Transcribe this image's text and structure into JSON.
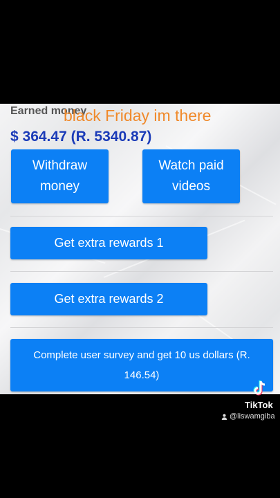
{
  "header": {
    "label": "Earned money",
    "overlay_text": "black Friday im there",
    "amount": "$ 364.47   (R. 5340.87)"
  },
  "buttons": {
    "withdraw_line1": "Withdraw",
    "withdraw_line2": "money",
    "watch_line1": "Watch paid",
    "watch_line2": "videos",
    "rewards1": "Get extra rewards 1",
    "rewards2": "Get extra rewards 2",
    "survey_line1": "Complete user survey and get 10 us dollars (R.",
    "survey_line2": "146.54)"
  },
  "watermark": {
    "app": "TikTok",
    "user": "@liswamgiba",
    "accent_pink": "#fe2c55",
    "accent_cyan": "#25f4ee"
  },
  "colors": {
    "button_blue": "#0c80f5",
    "amount_blue": "#1b3bb8",
    "overlay_orange": "#f0892a"
  }
}
